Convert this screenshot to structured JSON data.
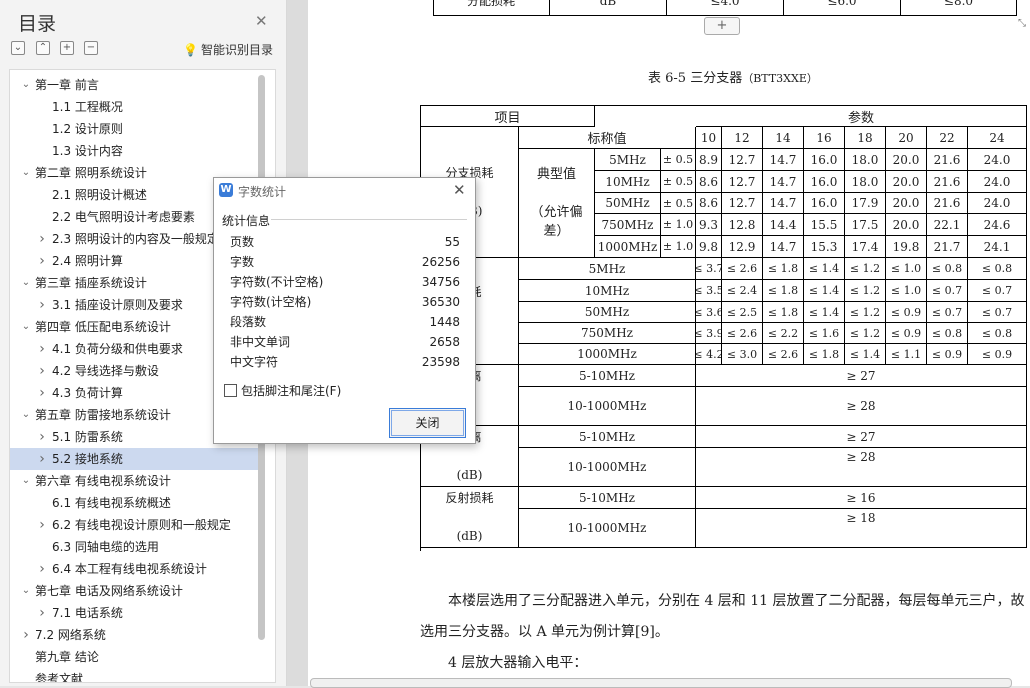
{
  "nav": {
    "title": "目录",
    "smart_label": "智能识别目录",
    "items": [
      {
        "label": "第一章  前言",
        "level": 0,
        "arrow": "down"
      },
      {
        "label": "1.1  工程概况",
        "level": 1,
        "arrow": ""
      },
      {
        "label": "1.2 设计原则",
        "level": 1,
        "arrow": ""
      },
      {
        "label": "1.3 设计内容",
        "level": 1,
        "arrow": ""
      },
      {
        "label": "第二章  照明系统设计",
        "level": 0,
        "arrow": "down"
      },
      {
        "label": "2.1  照明设计概述",
        "level": 1,
        "arrow": ""
      },
      {
        "label": "2.2  电气照明设计考虑要素",
        "level": 1,
        "arrow": ""
      },
      {
        "label": "2.3  照明设计的内容及一般规定",
        "level": 1,
        "arrow": "right"
      },
      {
        "label": "2.4  照明计算",
        "level": 1,
        "arrow": "right"
      },
      {
        "label": "第三章  插座系统设计",
        "level": 0,
        "arrow": "down"
      },
      {
        "label": "3.1  插座设计原则及要求",
        "level": 1,
        "arrow": "right"
      },
      {
        "label": "第四章  低压配电系统设计",
        "level": 0,
        "arrow": "down"
      },
      {
        "label": "4.1 负荷分级和供电要求",
        "level": 1,
        "arrow": "right"
      },
      {
        "label": "4.2  导线选择与敷设",
        "level": 1,
        "arrow": "right"
      },
      {
        "label": "4.3  负荷计算",
        "level": 1,
        "arrow": "right"
      },
      {
        "label": "第五章  防雷接地系统设计",
        "level": 0,
        "arrow": "down"
      },
      {
        "label": "5.1 防雷系统",
        "level": 1,
        "arrow": "right"
      },
      {
        "label": "5.2 接地系统",
        "level": 1,
        "arrow": "right",
        "selected": true
      },
      {
        "label": "第六章  有线电视系统设计",
        "level": 0,
        "arrow": "down"
      },
      {
        "label": "6.1 有线电视系统概述",
        "level": 1,
        "arrow": ""
      },
      {
        "label": "6.2 有线电视设计原则和一般规定",
        "level": 1,
        "arrow": "right"
      },
      {
        "label": "6.3 同轴电缆的选用",
        "level": 1,
        "arrow": ""
      },
      {
        "label": "6.4 本工程有线电视系统设计",
        "level": 1,
        "arrow": "right"
      },
      {
        "label": "第七章  电话及网络系统设计",
        "level": 0,
        "arrow": "down"
      },
      {
        "label": "7.1 电话系统",
        "level": 1,
        "arrow": "right"
      },
      {
        "label": "7.2 网络系统",
        "level": 0,
        "arrow": "right"
      },
      {
        "label": "第九章  结论",
        "level": 0,
        "arrow": ""
      },
      {
        "label": "参考文献",
        "level": 0,
        "arrow": ""
      }
    ]
  },
  "doc": {
    "top_row": [
      "分配损耗",
      "dB",
      "≤4.0",
      "≤6.0",
      "≤8.0"
    ],
    "caption_prefix": "表 6-5 三分支器",
    "caption_model": "（BTT3XXE）",
    "table": {
      "h_item": "项目",
      "h_param": "参数",
      "h_nominal": "标称值",
      "nominal": [
        "10",
        "12",
        "14",
        "16",
        "18",
        "20",
        "22",
        "24"
      ],
      "g1_label": [
        "分支损耗",
        "(dB)"
      ],
      "typical": [
        "典型值",
        "（允许偏",
        "差）"
      ],
      "g1_rows": [
        {
          "f": "5MHz",
          "tol": "± 0.5",
          "v": [
            "8.9",
            "12.7",
            "14.7",
            "16.0",
            "18.0",
            "20.0",
            "21.6",
            "24.0"
          ]
        },
        {
          "f": "10MHz",
          "tol": "± 0.5",
          "v": [
            "8.6",
            "12.7",
            "14.7",
            "16.0",
            "18.0",
            "20.0",
            "21.6",
            "24.0"
          ]
        },
        {
          "f": "50MHz",
          "tol": "± 0.5",
          "v": [
            "8.6",
            "12.7",
            "14.7",
            "16.0",
            "17.9",
            "20.0",
            "21.6",
            "24.0"
          ]
        },
        {
          "f": "750MHz",
          "tol": "± 1.0",
          "v": [
            "9.3",
            "12.8",
            "14.4",
            "15.5",
            "17.5",
            "20.0",
            "22.1",
            "24.6"
          ]
        },
        {
          "f": "1000MHz",
          "tol": "± 1.0",
          "v": [
            "9.8",
            "12.9",
            "14.7",
            "15.3",
            "17.4",
            "19.8",
            "21.7",
            "24.1"
          ]
        }
      ],
      "g2_label": [
        "损耗",
        "B)"
      ],
      "g2_rows": [
        {
          "f": "5MHz",
          "v": [
            "≤ 3.7",
            "≤ 2.6",
            "≤ 1.8",
            "≤ 1.4",
            "≤ 1.2",
            "≤ 1.0",
            "≤ 0.8",
            "≤ 0.8"
          ]
        },
        {
          "f": "10MHz",
          "v": [
            "≤ 3.5",
            "≤ 2.4",
            "≤ 1.8",
            "≤ 1.4",
            "≤ 1.2",
            "≤ 1.0",
            "≤ 0.7",
            "≤ 0.7"
          ]
        },
        {
          "f": "50MHz",
          "v": [
            "≤ 3.6",
            "≤ 2.5",
            "≤ 1.8",
            "≤ 1.4",
            "≤ 1.2",
            "≤ 0.9",
            "≤ 0.7",
            "≤ 0.7"
          ]
        },
        {
          "f": "750MHz",
          "v": [
            "≤ 3.9",
            "≤ 2.6",
            "≤ 2.2",
            "≤ 1.6",
            "≤ 1.2",
            "≤ 0.9",
            "≤ 0.8",
            "≤ 0.8"
          ]
        },
        {
          "f": "1000MHz",
          "v": [
            "≤ 4.2",
            "≤ 3.0",
            "≤ 2.6",
            "≤ 1.8",
            "≤ 1.4",
            "≤ 1.1",
            "≤ 0.9",
            "≤ 0.9"
          ]
        }
      ],
      "g3": {
        "label": [
          "隔离",
          "B)"
        ],
        "r1": [
          "5-10MHz",
          "≥ 27"
        ],
        "r2": [
          "10-1000MHz",
          "≥ 28"
        ]
      },
      "g4": {
        "label": [
          "隔离",
          "(dB)"
        ],
        "r1": [
          "5-10MHz",
          "≥ 27"
        ],
        "r2": [
          "10-1000MHz",
          "≥ 28"
        ]
      },
      "g5": {
        "label": [
          "反射损耗",
          "(dB)"
        ],
        "r1": [
          "5-10MHz",
          "≥ 16"
        ],
        "r2": [
          "10-1000MHz",
          "≥ 18"
        ]
      }
    },
    "para1": "本楼层选用了三分配器进入单元，分别在 4 层和 11 层放置了二分配器，每层每单元三户，故选用三分支器。以 A 单元为例计算[9]。",
    "para2": "4 层放大器输入电平："
  },
  "dialog": {
    "title": "字数统计",
    "group": "统计信息",
    "stats": [
      {
        "k": "页数",
        "v": "55"
      },
      {
        "k": "字数",
        "v": "26256"
      },
      {
        "k": "字符数(不计空格)",
        "v": "34756"
      },
      {
        "k": "字符数(计空格)",
        "v": "36530"
      },
      {
        "k": "段落数",
        "v": "1448"
      },
      {
        "k": "非中文单词",
        "v": "2658"
      },
      {
        "k": "中文字符",
        "v": "23598"
      }
    ],
    "checkbox_label": "包括脚注和尾注(F)",
    "close_label": "关闭"
  }
}
